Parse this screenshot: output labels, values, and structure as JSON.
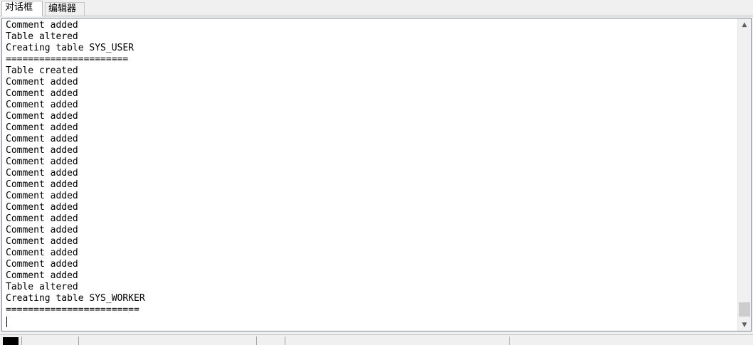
{
  "tabs": [
    {
      "label": "对话框"
    },
    {
      "label": "编辑器"
    }
  ],
  "output_lines": [
    "Comment added",
    "Table altered",
    "Creating table SYS_USER",
    "======================",
    "Table created",
    "Comment added",
    "Comment added",
    "Comment added",
    "Comment added",
    "Comment added",
    "Comment added",
    "Comment added",
    "Comment added",
    "Comment added",
    "Comment added",
    "Comment added",
    "Comment added",
    "Comment added",
    "Comment added",
    "Comment added",
    "Comment added",
    "Comment added",
    "Comment added",
    "Table altered",
    "Creating table SYS_WORKER",
    "========================"
  ],
  "scrollbar": {
    "up_icon": "▲",
    "down_icon": "▼"
  }
}
